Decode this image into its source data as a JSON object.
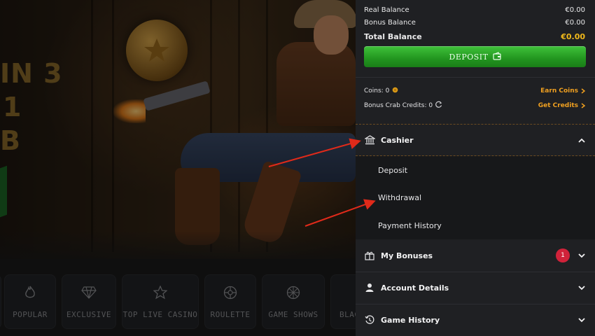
{
  "background": {
    "hero_text_lines": [
      "IN 3",
      "1",
      "B"
    ],
    "categories": [
      {
        "label": "",
        "icon": "category-icon"
      },
      {
        "label": "POPULAR",
        "icon": "flame-icon"
      },
      {
        "label": "EXCLUSIVE",
        "icon": "diamond-icon"
      },
      {
        "label": "TOP LIVE CASINO",
        "icon": "star-icon"
      },
      {
        "label": "ROULETTE",
        "icon": "roulette-wheel-icon"
      },
      {
        "label": "GAME SHOWS",
        "icon": "wheel-icon"
      },
      {
        "label": "BLAC",
        "icon": "cards-icon"
      }
    ]
  },
  "balances": {
    "real_label": "Real Balance",
    "real_value": "€0.00",
    "bonus_label": "Bonus Balance",
    "bonus_value": "€0.00",
    "total_label": "Total Balance",
    "total_value": "€0.00"
  },
  "deposit_button": {
    "label": "DEPOSIT",
    "icon": "wallet-icon"
  },
  "coins": {
    "label": "Coins: 0",
    "icon": "coin-icon",
    "link": "Earn Coins"
  },
  "credits": {
    "label": "Bonus Crab Credits: 0",
    "icon": "credits-icon",
    "link": "Get Credits"
  },
  "menu": {
    "cashier": {
      "label": "Cashier",
      "icon": "bank-icon",
      "expanded": true
    },
    "cashier_items": [
      "Deposit",
      "Withdrawal",
      "Payment History"
    ],
    "bonuses": {
      "label": "My Bonuses",
      "icon": "gift-icon",
      "badge": "1"
    },
    "account": {
      "label": "Account Details",
      "icon": "user-icon"
    },
    "history": {
      "label": "Game History",
      "icon": "history-icon"
    }
  },
  "colors": {
    "panel_bg": "#1f2023",
    "accent_orange": "#f0a020",
    "gold": "#f0b81a",
    "deposit_green": "#2aa526",
    "badge_red": "#d0223a",
    "annotation_arrow": "#e02a1a"
  }
}
